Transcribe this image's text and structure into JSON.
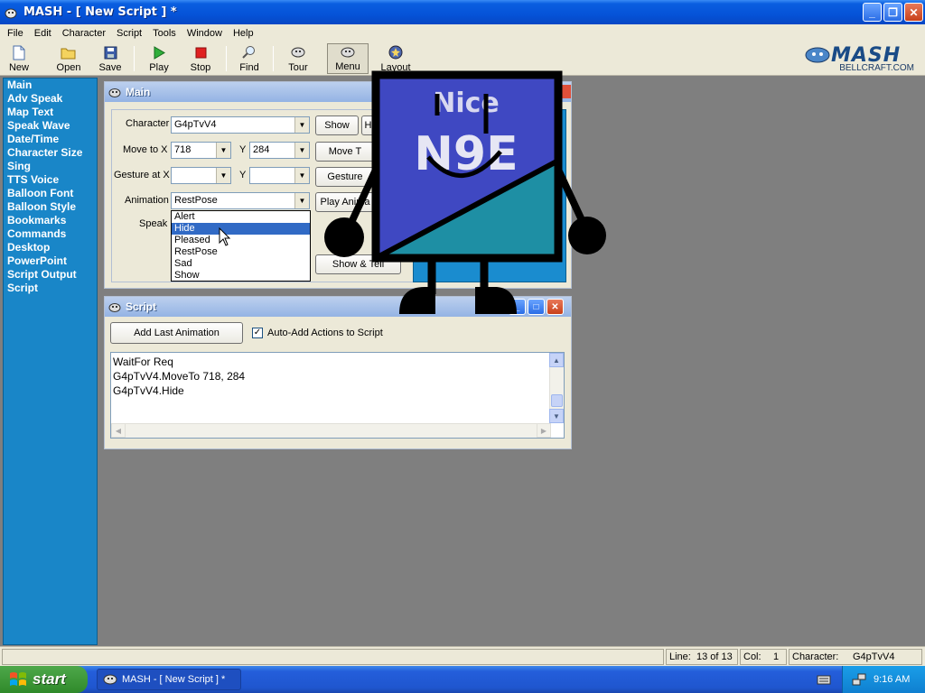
{
  "app": {
    "title": "MASH - [ New Script ] *"
  },
  "menu": [
    "File",
    "Edit",
    "Character",
    "Script",
    "Tools",
    "Window",
    "Help"
  ],
  "toolbar": {
    "new": "New",
    "open": "Open",
    "save": "Save",
    "play": "Play",
    "stop": "Stop",
    "find": "Find",
    "tour": "Tour",
    "menu": "Menu",
    "layout": "Layout"
  },
  "logo": {
    "brand": "MASH",
    "url": "BELLCRAFT.COM"
  },
  "sidebar": {
    "items": [
      "Main",
      "Adv Speak",
      "Map Text",
      "Speak Wave",
      "Date/Time",
      "Character Size",
      "Sing",
      "TTS Voice",
      "Balloon Font",
      "Balloon Style",
      "Bookmarks",
      "Commands",
      "Desktop",
      "PowerPoint",
      "Script Output",
      "Script"
    ]
  },
  "main_window": {
    "title": "Main",
    "character_label": "Character",
    "character_value": "G4pTvV4",
    "show_button": "Show",
    "hide_button_partial": "H",
    "move_to_x_label": "Move to X",
    "move_x_value": "718",
    "y_label": "Y",
    "move_y_value": "284",
    "move_to_button": "Move T",
    "gesture_at_x_label": "Gesture at X",
    "gesture_button": "Gesture",
    "animation_label": "Animation",
    "animation_value": "RestPose",
    "play_animation_button": "Play Anima",
    "speak_label": "Speak",
    "show_tell_button": "Show & Tell",
    "animation_options": [
      "Alert",
      "Hide",
      "Pleased",
      "RestPose",
      "Sad",
      "Show"
    ],
    "animation_selected": "Hide"
  },
  "script_window": {
    "title": "Script",
    "add_last_animation_button": "Add Last Animation",
    "auto_add_label": "Auto-Add Actions to Script",
    "auto_add_checked": true,
    "lines": [
      "WaitFor Req",
      "G4pTvV4.MoveTo 718, 284",
      "G4pTvV4.Hide"
    ]
  },
  "character": {
    "line1": "Nice",
    "line2": "N9E"
  },
  "statusbar": {
    "line_label": "Line:",
    "line_value": "13 of 13",
    "col_label": "Col:",
    "col_value": "1",
    "character_label": "Character:",
    "character_value": "G4pTvV4"
  },
  "taskbar": {
    "start": "start",
    "task": "MASH - [ New Script ] *",
    "time": "9:16 AM"
  }
}
